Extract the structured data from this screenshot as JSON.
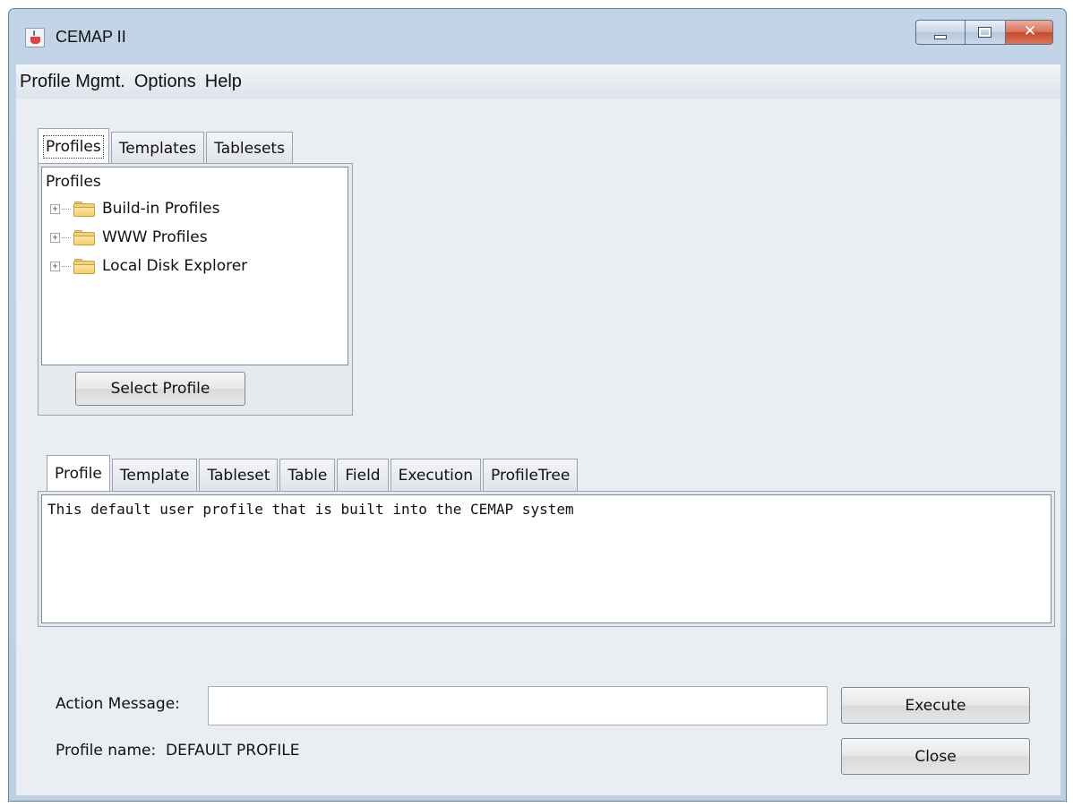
{
  "window": {
    "title": "CEMAP II"
  },
  "menu": [
    "Profile Mgmt.",
    "Options",
    "Help"
  ],
  "top_tabs": [
    "Profiles",
    "Templates",
    "Tablesets"
  ],
  "tree": {
    "root": "Profiles",
    "nodes": [
      "Build-in Profiles",
      "WWW Profiles",
      "Local Disk Explorer"
    ]
  },
  "select_profile_label": "Select Profile",
  "detail_tabs": [
    "Profile",
    "Template",
    "Tableset",
    "Table",
    "Field",
    "Execution",
    "ProfileTree"
  ],
  "profile_description": "This default user profile that is built into the CEMAP system",
  "action": {
    "label": "Action Message:",
    "value": ""
  },
  "profile_name": {
    "label": "Profile name:",
    "value": "DEFAULT PROFILE"
  },
  "buttons": {
    "execute": "Execute",
    "close": "Close"
  },
  "icons": {
    "app": "java-cup-icon",
    "folder": "folder-icon",
    "expander": "plus-expander-icon"
  }
}
